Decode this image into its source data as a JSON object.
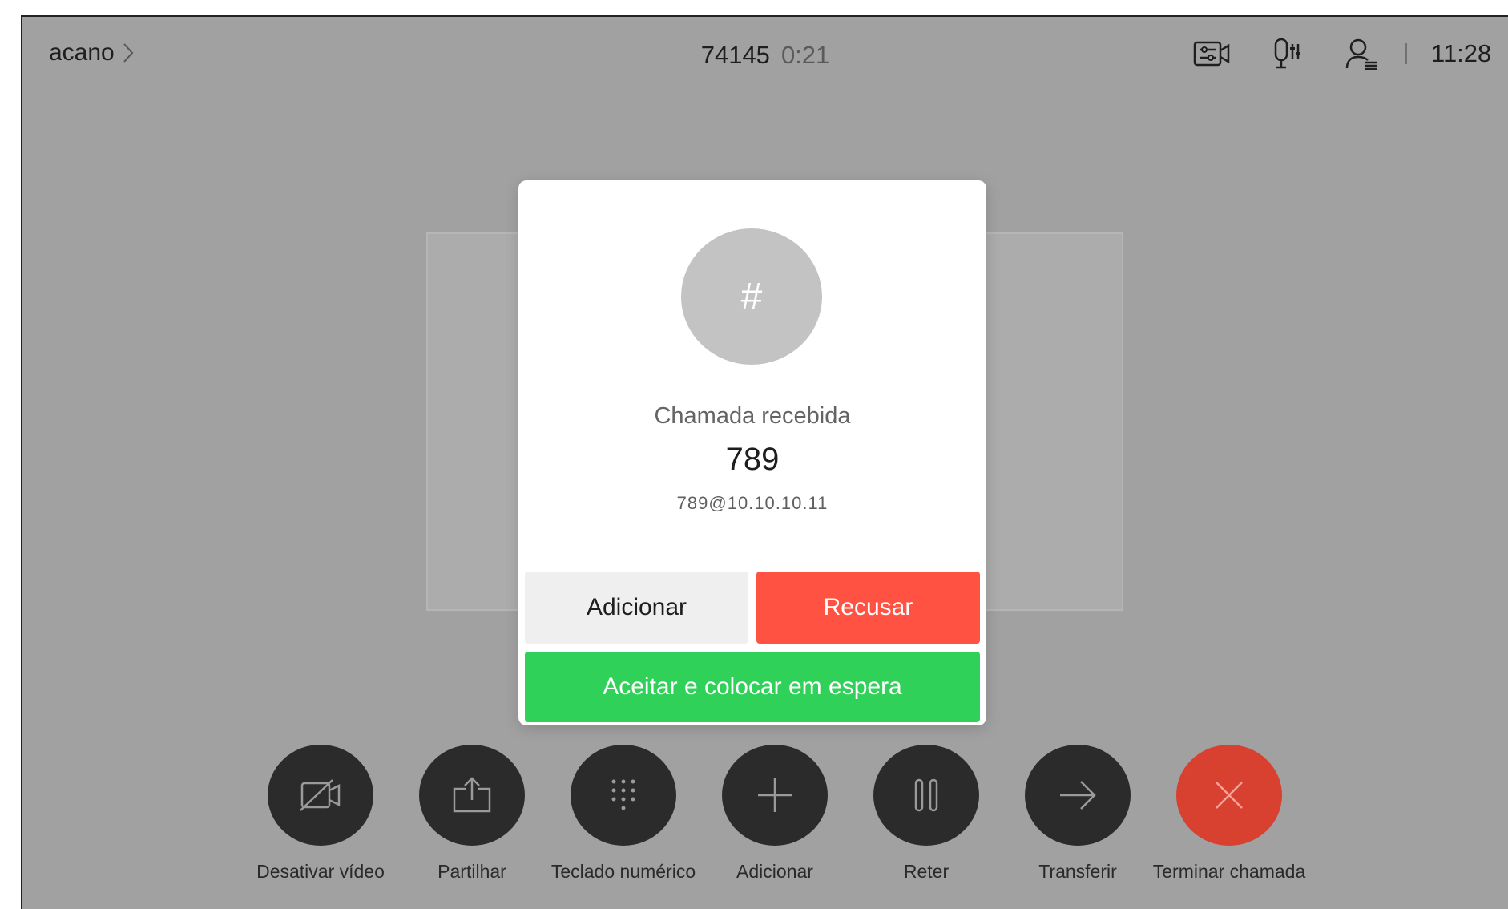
{
  "header": {
    "room_name": "acano",
    "call_number": "74145",
    "call_duration": "0:21",
    "status_icons": [
      "camera-settings-icon",
      "microphone-settings-icon",
      "participants-icon"
    ],
    "time": "11:28"
  },
  "dialog": {
    "avatar_symbol": "#",
    "title": "Chamada recebida",
    "caller_name": "789",
    "caller_uri": "789@10.10.10.11",
    "add_label": "Adicionar",
    "decline_label": "Recusar",
    "accept_hold_label": "Aceitar e colocar em espera"
  },
  "controls": [
    {
      "icon": "video-off-icon",
      "label": "Desativar vídeo"
    },
    {
      "icon": "share-icon",
      "label": "Partilhar"
    },
    {
      "icon": "keypad-icon",
      "label": "Teclado numérico"
    },
    {
      "icon": "plus-icon",
      "label": "Adicionar"
    },
    {
      "icon": "pause-icon",
      "label": "Reter"
    },
    {
      "icon": "arrow-right-icon",
      "label": "Transferir"
    },
    {
      "icon": "close-icon",
      "label": "Terminar chamada"
    }
  ],
  "colors": {
    "decline": "#ff5242",
    "accept": "#30d158",
    "end_call": "#d8402f",
    "control": "#2b2b2b"
  }
}
